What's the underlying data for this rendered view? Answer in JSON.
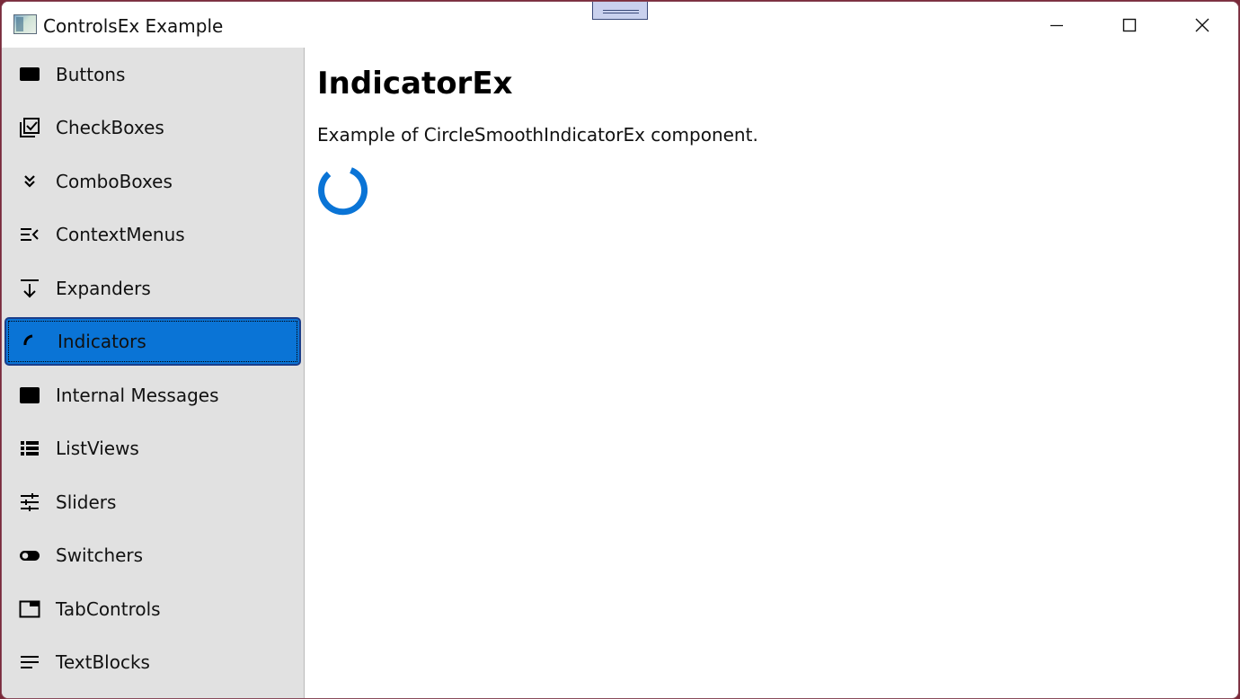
{
  "window": {
    "title": "ControlsEx Example",
    "minimize_icon": "minimize-icon",
    "maximize_icon": "maximize-icon",
    "close_icon": "close-icon"
  },
  "sidebar": {
    "selected": "Indicators",
    "accent_color": "#0a74d6",
    "items": [
      {
        "label": "Buttons",
        "icon": "button-icon"
      },
      {
        "label": "CheckBoxes",
        "icon": "checkbox-icon"
      },
      {
        "label": "ComboBoxes",
        "icon": "double-chevron-down-icon"
      },
      {
        "label": "ContextMenus",
        "icon": "context-menu-icon"
      },
      {
        "label": "Expanders",
        "icon": "expander-arrow-icon"
      },
      {
        "label": "Indicators",
        "icon": "indicator-arc-icon"
      },
      {
        "label": "Internal Messages",
        "icon": "message-window-icon"
      },
      {
        "label": "ListViews",
        "icon": "list-view-icon"
      },
      {
        "label": "Sliders",
        "icon": "sliders-icon"
      },
      {
        "label": "Switchers",
        "icon": "toggle-switch-icon"
      },
      {
        "label": "TabControls",
        "icon": "tab-icon"
      },
      {
        "label": "TextBlocks",
        "icon": "text-lines-icon"
      }
    ]
  },
  "main": {
    "title": "IndicatorEx",
    "description": "Example of CircleSmoothIndicatorEx component.",
    "indicator_color": "#0a74d6"
  }
}
